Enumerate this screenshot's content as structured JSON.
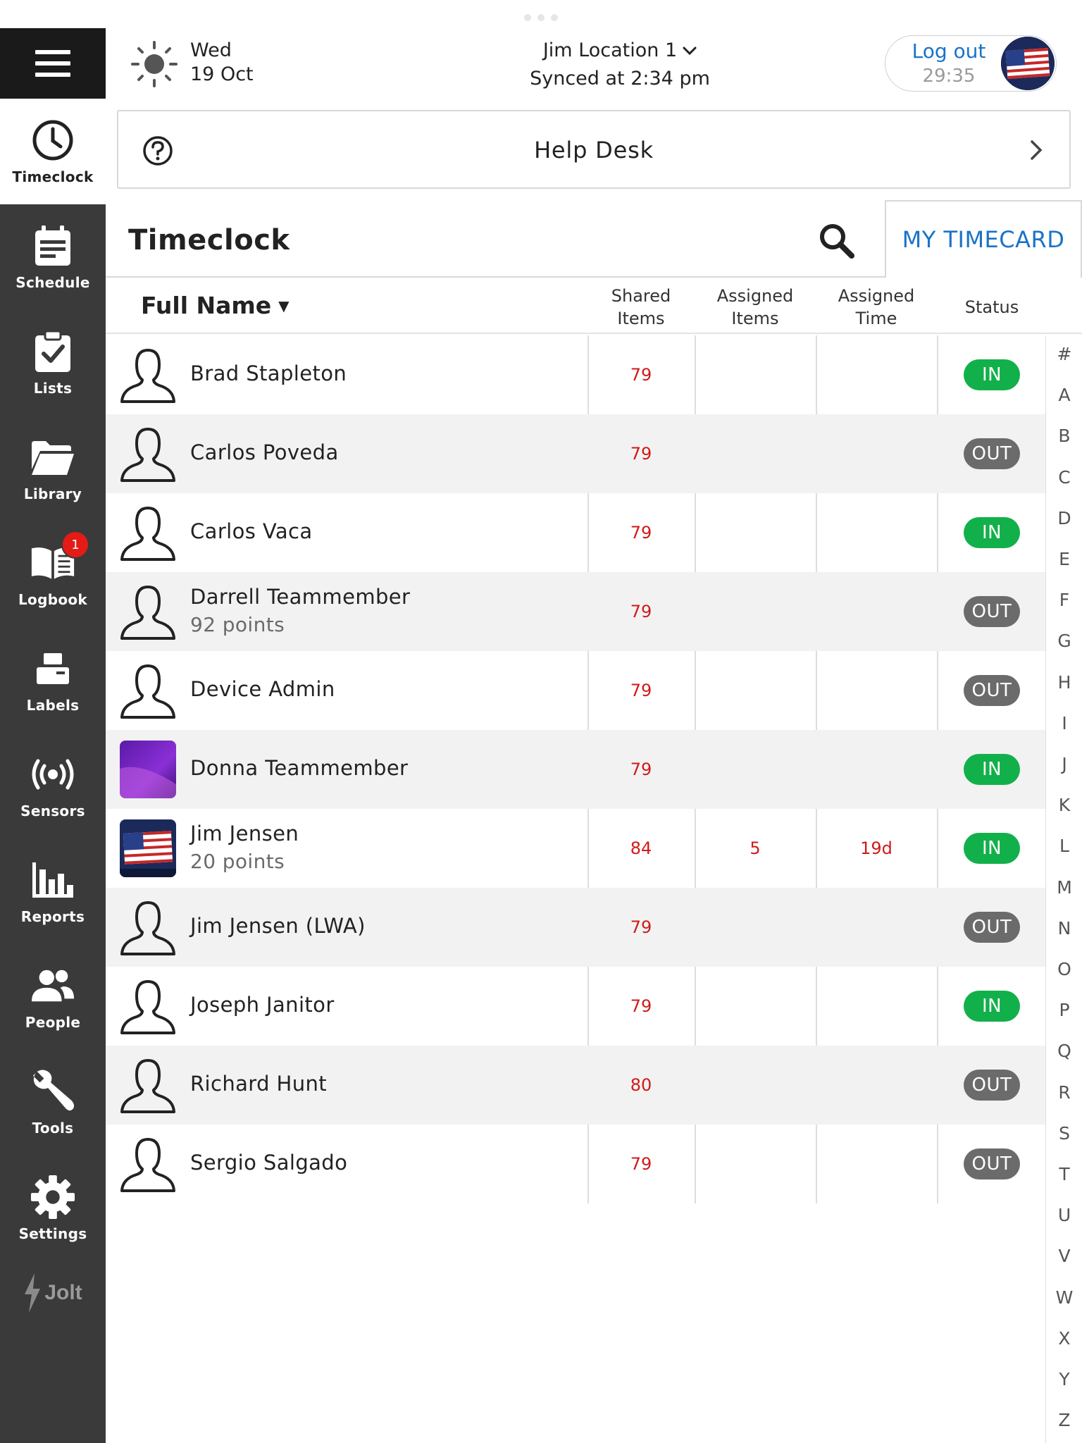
{
  "header": {
    "day": "Wed",
    "date": "19 Oct",
    "location": "Jim Location 1",
    "synced": "Synced at 2:34 pm",
    "logout_label": "Log out",
    "session_timer": "29:35"
  },
  "helpdesk": {
    "label": "Help Desk"
  },
  "page": {
    "title": "Timeclock",
    "my_timecard_label": "MY TIMECARD"
  },
  "sidebar": {
    "items": [
      {
        "label": "Timeclock",
        "icon": "clock-icon"
      },
      {
        "label": "Schedule",
        "icon": "calendar-icon"
      },
      {
        "label": "Lists",
        "icon": "clipboard-check-icon"
      },
      {
        "label": "Library",
        "icon": "folder-icon"
      },
      {
        "label": "Logbook",
        "icon": "book-icon",
        "badge": "1"
      },
      {
        "label": "Labels",
        "icon": "printer-icon"
      },
      {
        "label": "Sensors",
        "icon": "sensor-icon"
      },
      {
        "label": "Reports",
        "icon": "bar-chart-icon"
      },
      {
        "label": "People",
        "icon": "people-icon"
      },
      {
        "label": "Tools",
        "icon": "wrench-icon"
      },
      {
        "label": "Settings",
        "icon": "gear-icon"
      }
    ],
    "brand": "Jolt"
  },
  "table": {
    "name_header": "Full Name",
    "columns": [
      "Shared\nItems",
      "Assigned\nItems",
      "Assigned\nTime",
      "Status"
    ],
    "rows": [
      {
        "name": "Brad Stapleton",
        "points": "",
        "shared": "79",
        "assigned_items": "",
        "assigned_time": "",
        "status": "IN"
      },
      {
        "name": "Carlos Poveda",
        "points": "",
        "shared": "79",
        "assigned_items": "",
        "assigned_time": "",
        "status": "OUT"
      },
      {
        "name": "Carlos Vaca",
        "points": "",
        "shared": "79",
        "assigned_items": "",
        "assigned_time": "",
        "status": "IN"
      },
      {
        "name": "Darrell Teammember",
        "points": "92 points",
        "shared": "79",
        "assigned_items": "",
        "assigned_time": "",
        "status": "OUT"
      },
      {
        "name": "Device Admin",
        "points": "",
        "shared": "79",
        "assigned_items": "",
        "assigned_time": "",
        "status": "OUT"
      },
      {
        "name": "Donna Teammember",
        "points": "",
        "shared": "79",
        "assigned_items": "",
        "assigned_time": "",
        "status": "IN"
      },
      {
        "name": "Jim Jensen",
        "points": "20 points",
        "shared": "84",
        "assigned_items": "5",
        "assigned_time": "19d",
        "status": "IN"
      },
      {
        "name": "Jim Jensen (LWA)",
        "points": "",
        "shared": "79",
        "assigned_items": "",
        "assigned_time": "",
        "status": "OUT"
      },
      {
        "name": "Joseph Janitor",
        "points": "",
        "shared": "79",
        "assigned_items": "",
        "assigned_time": "",
        "status": "IN"
      },
      {
        "name": "Richard Hunt",
        "points": "",
        "shared": "80",
        "assigned_items": "",
        "assigned_time": "",
        "status": "OUT"
      },
      {
        "name": "Sergio Salgado",
        "points": "",
        "shared": "79",
        "assigned_items": "",
        "assigned_time": "",
        "status": "OUT"
      }
    ]
  },
  "alpha_index": [
    "#",
    "A",
    "B",
    "C",
    "D",
    "E",
    "F",
    "G",
    "H",
    "I",
    "J",
    "K",
    "L",
    "M",
    "N",
    "O",
    "P",
    "Q",
    "R",
    "S",
    "T",
    "U",
    "V",
    "W",
    "X",
    "Y",
    "Z"
  ],
  "colors": {
    "accent_blue": "#1a73c8",
    "status_in": "#12b04a",
    "status_out": "#6b6b6b",
    "value_red": "#d11a1a",
    "sidebar_bg": "#3a3a3a",
    "badge_red": "#e41b17"
  }
}
